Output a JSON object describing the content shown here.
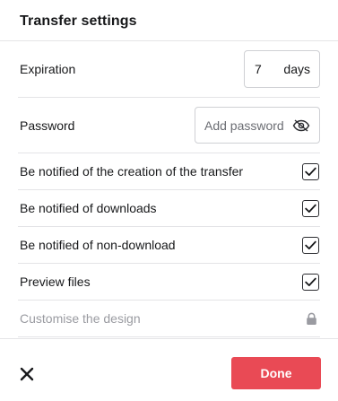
{
  "header": {
    "title": "Transfer settings"
  },
  "expiration": {
    "label": "Expiration",
    "value": "7",
    "unit": "days"
  },
  "password": {
    "label": "Password",
    "placeholder": "Add password",
    "icon": "eye-slash-icon"
  },
  "options": [
    {
      "label": "Be notified of the creation of the transfer",
      "checked": true
    },
    {
      "label": "Be notified of downloads",
      "checked": true
    },
    {
      "label": "Be notified of non-download",
      "checked": true
    },
    {
      "label": "Preview files",
      "checked": true
    }
  ],
  "design": {
    "label": "Customise the design",
    "icon": "lock-icon",
    "locked": true
  },
  "footer": {
    "close_icon": "close-icon",
    "done_label": "Done"
  },
  "colors": {
    "accent": "#e94a55",
    "text": "#17181a",
    "muted": "#9a9ba1",
    "border": "#e4e4e7"
  }
}
